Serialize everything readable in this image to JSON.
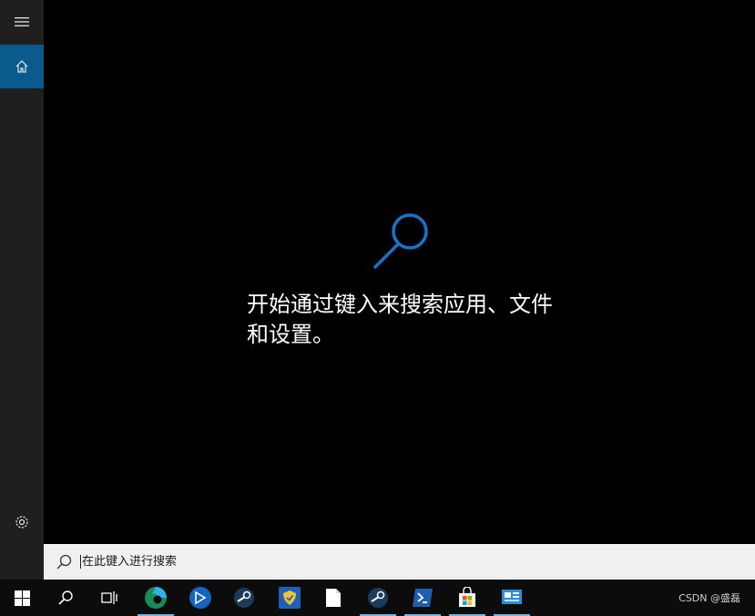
{
  "left_rail": {
    "menu_icon": "hamburger-icon",
    "home_icon": "home-icon",
    "settings_icon": "gear-icon"
  },
  "main": {
    "hero_icon": "search-icon",
    "hero_line1": "开始通过键入来搜索应用、文件",
    "hero_line2": "和设置。"
  },
  "search": {
    "placeholder": "在此键入进行搜索"
  },
  "taskbar": {
    "apps": [
      "start",
      "search",
      "task-view",
      "edge",
      "feedback",
      "steam",
      "defender",
      "file",
      "steam-2",
      "powershell",
      "store",
      "remote"
    ],
    "tray_text": "CSDN @盛磊"
  },
  "colors": {
    "accent": "#0a5a8e",
    "search_blue": "#1a73c9"
  }
}
